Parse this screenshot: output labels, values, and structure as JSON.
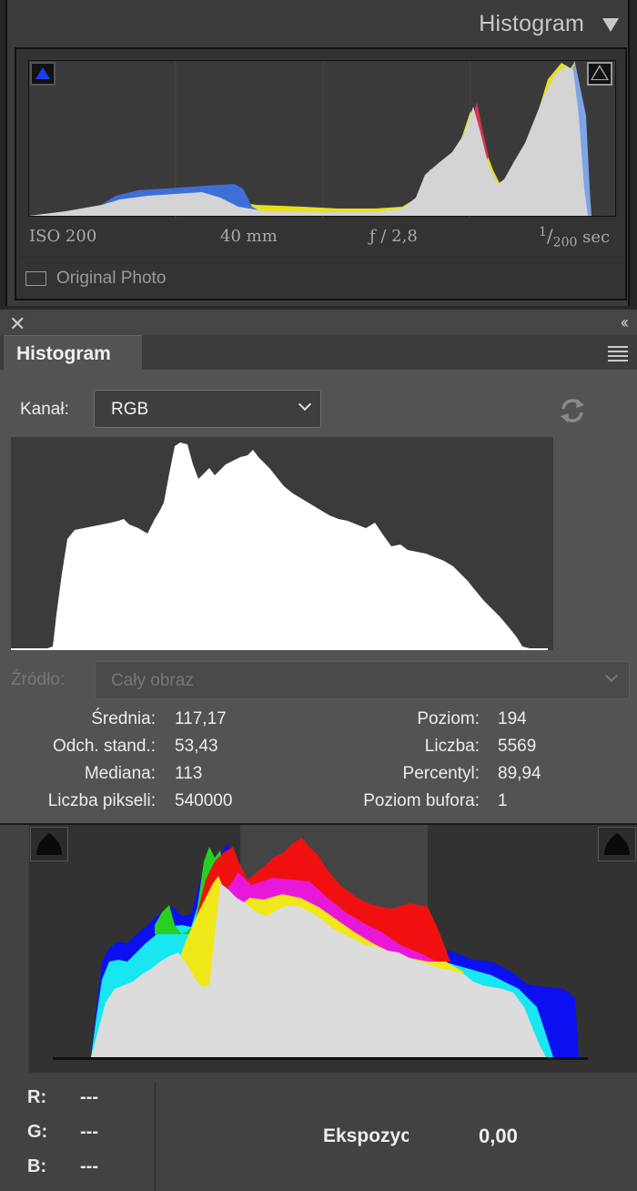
{
  "lightroom": {
    "title": "Histogram",
    "exif": {
      "iso": "ISO 200",
      "focal": "40 mm",
      "aperture": "ƒ / 2,8",
      "shutter_num": "1",
      "shutter_den": "200",
      "shutter_unit": "sec"
    },
    "original_photo_label": "Original Photo",
    "clip_shadow_color": "#1a3cf0"
  },
  "photoshop": {
    "tab_title": "Histogram",
    "channel_label": "Kanał:",
    "channel_value": "RGB",
    "source_label": "Źródło:",
    "source_value": "Cały obraz",
    "stats_left": [
      {
        "label": "Średnia:",
        "value": "117,17"
      },
      {
        "label": "Odch. stand.:",
        "value": "53,43"
      },
      {
        "label": "Mediana:",
        "value": "113"
      },
      {
        "label": "Liczba pikseli:",
        "value": "540000"
      }
    ],
    "stats_right": [
      {
        "label": "Poziom:",
        "value": "194"
      },
      {
        "label": "Liczba:",
        "value": "5569"
      },
      {
        "label": "Percentyl:",
        "value": "89,94"
      },
      {
        "label": "Poziom bufora:",
        "value": "1"
      }
    ]
  },
  "camera_raw": {
    "r_label": "R:",
    "r_value": "---",
    "g_label": "G:",
    "g_value": "---",
    "b_label": "B:",
    "b_value": "---",
    "exposure_label": "Ekspozycja",
    "exposure_value": "0,00"
  }
}
